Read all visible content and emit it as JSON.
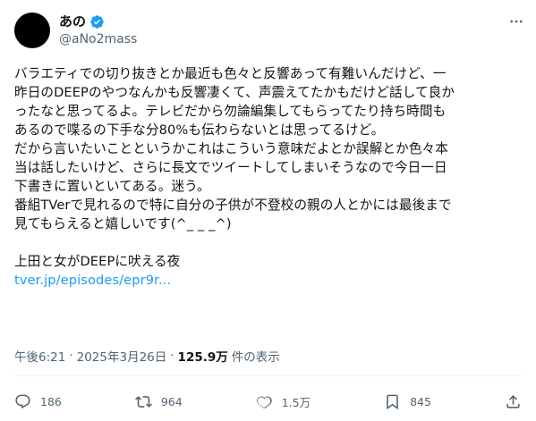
{
  "author": {
    "display_name": "あの",
    "handle": "@aNo2mass",
    "verified_color": "#1d9bf0"
  },
  "icons": {
    "verified": "verified-badge-icon",
    "more": "more-icon",
    "reply": "reply-icon",
    "retweet": "retweet-icon",
    "like": "heart-icon",
    "bookmark": "bookmark-icon",
    "share": "share-icon"
  },
  "tweet": {
    "lines": [
      "バラエティでの切り抜きとか最近も色々と反響あって有難いんだけど、一",
      "昨日のDEEPのやつなんかも反響凄くて、声震えてたかもだけど話して良か",
      "ったなと思ってるよ。テレビだから勿論編集してもらってたり持ち時間も",
      "あるので喋るの下手な分80%も伝わらないとは思ってるけど。",
      "だから言いたいことというかこれはこういう意味だよとか誤解とか色々本",
      "当は話したいけど、さらに長文でツイートしてしまいそうなので今日一日",
      "下書きに置いといてある。迷う。",
      "番組TVerで見れるので特に自分の子供が不登校の親の人とかには最後まで",
      "見てもらえると嬉しいです(^_ _ _^)"
    ],
    "program_title": "上田と女がDEEPに吠える夜",
    "link_text": "tver.jp/episodes/epr9r..."
  },
  "meta": {
    "time": "午後6:21",
    "separator": "·",
    "date": "2025年3月26日",
    "views": "125.9万",
    "views_label": "件の表示"
  },
  "actions": {
    "replies": "186",
    "retweets": "964",
    "likes": "1.5万",
    "bookmarks": "845"
  },
  "colors": {
    "text": "#0f1419",
    "secondary": "#536471",
    "link": "#1d9bf0"
  }
}
